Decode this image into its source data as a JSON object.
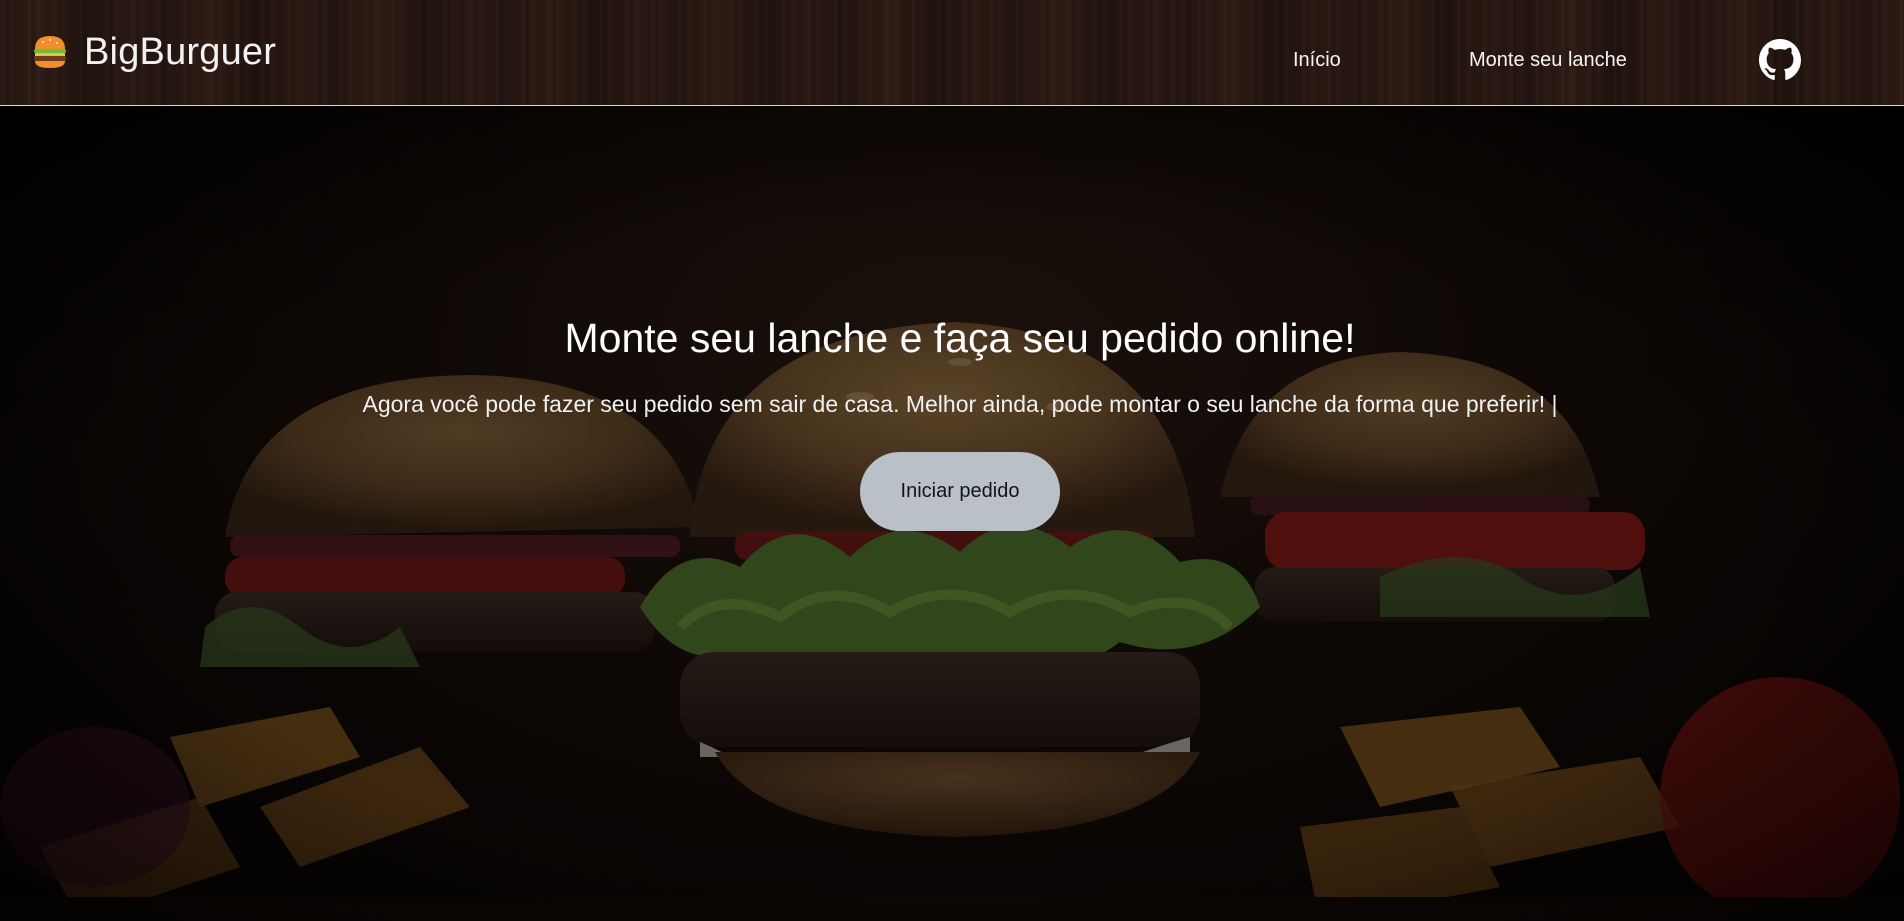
{
  "header": {
    "brand": "BigBurguer",
    "nav": [
      {
        "label": "Início"
      },
      {
        "label": "Monte seu lanche"
      }
    ],
    "github_icon": "github-icon",
    "brand_icon": "burger-icon"
  },
  "hero": {
    "title": "Monte seu lanche e faça seu pedido online!",
    "subtitle": "Agora você pode fazer seu pedido sem sair de casa. Melhor ainda, pode montar o seu lanche da forma que preferir! |",
    "cta_label": "Iniciar pedido",
    "background_image": "burgers-photo"
  },
  "colors": {
    "header_bg": "#24150f",
    "cta_bg": "#b9c0c8",
    "text": "#ffffff"
  }
}
